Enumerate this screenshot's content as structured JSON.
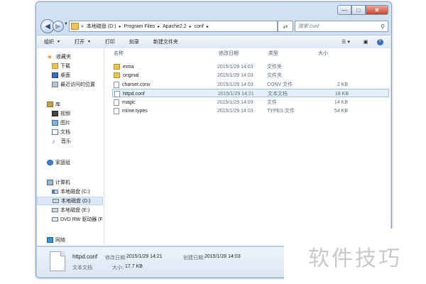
{
  "window": {
    "caption_buttons": {
      "minimize": "—",
      "maximize": "□",
      "close": "✕"
    }
  },
  "address_bar": {
    "overflow": "«",
    "crumbs": [
      "本地磁盘 (D:)",
      "Program Files",
      "Apache2.2",
      "conf"
    ],
    "search_placeholder": "搜索 conf"
  },
  "toolbar": {
    "organize": "组织",
    "open": "打开",
    "print": "打印",
    "burn": "刻录",
    "new_folder": "新建文件夹"
  },
  "nav": {
    "favorites": {
      "label": "收藏夹",
      "items": [
        "下载",
        "桌面",
        "最近访问的位置"
      ]
    },
    "libraries": {
      "label": "库",
      "items": [
        "视频",
        "图片",
        "文档",
        "音乐"
      ]
    },
    "homegroup": "家庭组",
    "computer": {
      "label": "计算机",
      "items": [
        "本地磁盘 (C:)",
        "本地磁盘 (D:)",
        "本地磁盘 (E:)",
        "DVD RW 驱动器 (F:"
      ]
    },
    "network": "网络"
  },
  "columns": {
    "name": "名称",
    "date": "修改日期",
    "type": "类型",
    "size": "大小"
  },
  "files": [
    {
      "name": "extra",
      "date": "2015/1/29 14:03",
      "type": "文件夹",
      "size": "",
      "icon": "folder"
    },
    {
      "name": "original",
      "date": "2015/1/29 14:03",
      "type": "文件夹",
      "size": "",
      "icon": "folder"
    },
    {
      "name": "charset.conv",
      "date": "2015/1/29 14:03",
      "type": "CONV 文件",
      "size": "2 KB",
      "icon": "file"
    },
    {
      "name": "httpd.conf",
      "date": "2015/1/29 14:21",
      "type": "文本文档",
      "size": "18 KB",
      "icon": "file"
    },
    {
      "name": "magic",
      "date": "2015/1/29 14:03",
      "type": "文件",
      "size": "14 KB",
      "icon": "file"
    },
    {
      "name": "mime.types",
      "date": "2015/1/29 14:03",
      "type": "TYPES 文件",
      "size": "54 KB",
      "icon": "file"
    }
  ],
  "details": {
    "filename": "httpd.conf",
    "modified_label": "修改日期:",
    "modified": "2015/1/29 14:21",
    "created_label": "创建日期:",
    "created": "2015/1/28 14:03",
    "type": "文本文档",
    "size_label": "大小:",
    "size": "17.7 KB"
  },
  "watermark": "软件技巧"
}
